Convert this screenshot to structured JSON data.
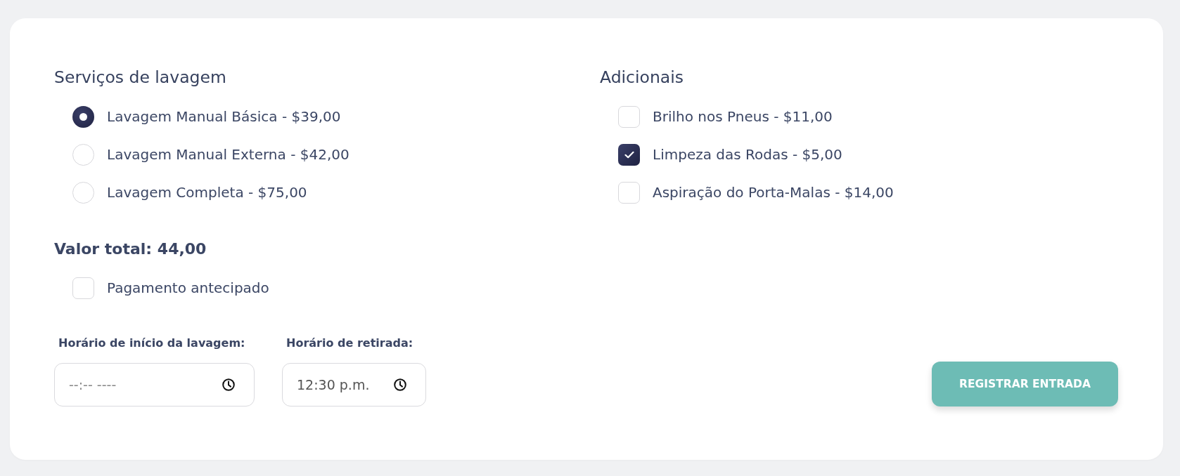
{
  "services": {
    "title": "Serviços de lavagem",
    "options": [
      {
        "label": "Lavagem Manual Básica - $39,00",
        "selected": true
      },
      {
        "label": "Lavagem Manual Externa - $42,00",
        "selected": false
      },
      {
        "label": "Lavagem Completa - $75,00",
        "selected": false
      }
    ]
  },
  "extras": {
    "title": "Adicionais",
    "options": [
      {
        "label": "Brilho nos Pneus - $11,00",
        "checked": false
      },
      {
        "label": "Limpeza das Rodas - $5,00",
        "checked": true
      },
      {
        "label": "Aspiração do Porta-Malas - $14,00",
        "checked": false
      }
    ]
  },
  "total": {
    "label": "Valor total: 44,00"
  },
  "prepaid": {
    "label": "Pagamento antecipado",
    "checked": false
  },
  "times": [
    {
      "label": "Horário de início da lavagem:",
      "placeholder": "--:-- ----"
    },
    {
      "label": "Horário de retirada:",
      "value": "12:30 p.m."
    }
  ],
  "submit_button": {
    "label": "REGISTRAR ENTRADA"
  }
}
